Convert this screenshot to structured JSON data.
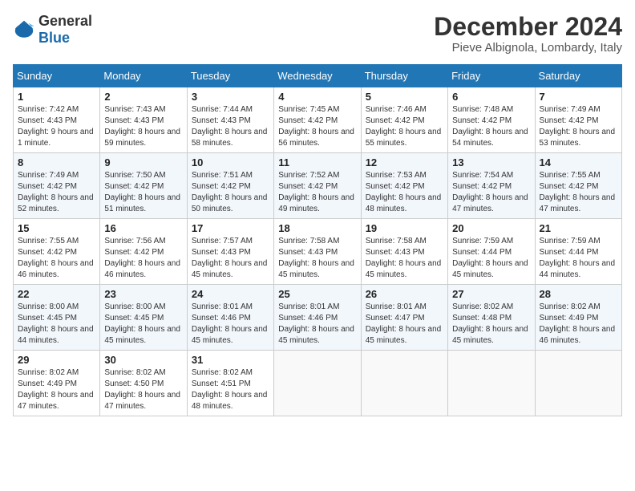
{
  "header": {
    "logo_general": "General",
    "logo_blue": "Blue",
    "title": "December 2024",
    "subtitle": "Pieve Albignola, Lombardy, Italy"
  },
  "weekdays": [
    "Sunday",
    "Monday",
    "Tuesday",
    "Wednesday",
    "Thursday",
    "Friday",
    "Saturday"
  ],
  "weeks": [
    [
      {
        "day": "1",
        "sunrise": "Sunrise: 7:42 AM",
        "sunset": "Sunset: 4:43 PM",
        "daylight": "Daylight: 9 hours and 1 minute."
      },
      {
        "day": "2",
        "sunrise": "Sunrise: 7:43 AM",
        "sunset": "Sunset: 4:43 PM",
        "daylight": "Daylight: 8 hours and 59 minutes."
      },
      {
        "day": "3",
        "sunrise": "Sunrise: 7:44 AM",
        "sunset": "Sunset: 4:43 PM",
        "daylight": "Daylight: 8 hours and 58 minutes."
      },
      {
        "day": "4",
        "sunrise": "Sunrise: 7:45 AM",
        "sunset": "Sunset: 4:42 PM",
        "daylight": "Daylight: 8 hours and 56 minutes."
      },
      {
        "day": "5",
        "sunrise": "Sunrise: 7:46 AM",
        "sunset": "Sunset: 4:42 PM",
        "daylight": "Daylight: 8 hours and 55 minutes."
      },
      {
        "day": "6",
        "sunrise": "Sunrise: 7:48 AM",
        "sunset": "Sunset: 4:42 PM",
        "daylight": "Daylight: 8 hours and 54 minutes."
      },
      {
        "day": "7",
        "sunrise": "Sunrise: 7:49 AM",
        "sunset": "Sunset: 4:42 PM",
        "daylight": "Daylight: 8 hours and 53 minutes."
      }
    ],
    [
      {
        "day": "8",
        "sunrise": "Sunrise: 7:49 AM",
        "sunset": "Sunset: 4:42 PM",
        "daylight": "Daylight: 8 hours and 52 minutes."
      },
      {
        "day": "9",
        "sunrise": "Sunrise: 7:50 AM",
        "sunset": "Sunset: 4:42 PM",
        "daylight": "Daylight: 8 hours and 51 minutes."
      },
      {
        "day": "10",
        "sunrise": "Sunrise: 7:51 AM",
        "sunset": "Sunset: 4:42 PM",
        "daylight": "Daylight: 8 hours and 50 minutes."
      },
      {
        "day": "11",
        "sunrise": "Sunrise: 7:52 AM",
        "sunset": "Sunset: 4:42 PM",
        "daylight": "Daylight: 8 hours and 49 minutes."
      },
      {
        "day": "12",
        "sunrise": "Sunrise: 7:53 AM",
        "sunset": "Sunset: 4:42 PM",
        "daylight": "Daylight: 8 hours and 48 minutes."
      },
      {
        "day": "13",
        "sunrise": "Sunrise: 7:54 AM",
        "sunset": "Sunset: 4:42 PM",
        "daylight": "Daylight: 8 hours and 47 minutes."
      },
      {
        "day": "14",
        "sunrise": "Sunrise: 7:55 AM",
        "sunset": "Sunset: 4:42 PM",
        "daylight": "Daylight: 8 hours and 47 minutes."
      }
    ],
    [
      {
        "day": "15",
        "sunrise": "Sunrise: 7:55 AM",
        "sunset": "Sunset: 4:42 PM",
        "daylight": "Daylight: 8 hours and 46 minutes."
      },
      {
        "day": "16",
        "sunrise": "Sunrise: 7:56 AM",
        "sunset": "Sunset: 4:42 PM",
        "daylight": "Daylight: 8 hours and 46 minutes."
      },
      {
        "day": "17",
        "sunrise": "Sunrise: 7:57 AM",
        "sunset": "Sunset: 4:43 PM",
        "daylight": "Daylight: 8 hours and 45 minutes."
      },
      {
        "day": "18",
        "sunrise": "Sunrise: 7:58 AM",
        "sunset": "Sunset: 4:43 PM",
        "daylight": "Daylight: 8 hours and 45 minutes."
      },
      {
        "day": "19",
        "sunrise": "Sunrise: 7:58 AM",
        "sunset": "Sunset: 4:43 PM",
        "daylight": "Daylight: 8 hours and 45 minutes."
      },
      {
        "day": "20",
        "sunrise": "Sunrise: 7:59 AM",
        "sunset": "Sunset: 4:44 PM",
        "daylight": "Daylight: 8 hours and 45 minutes."
      },
      {
        "day": "21",
        "sunrise": "Sunrise: 7:59 AM",
        "sunset": "Sunset: 4:44 PM",
        "daylight": "Daylight: 8 hours and 44 minutes."
      }
    ],
    [
      {
        "day": "22",
        "sunrise": "Sunrise: 8:00 AM",
        "sunset": "Sunset: 4:45 PM",
        "daylight": "Daylight: 8 hours and 44 minutes."
      },
      {
        "day": "23",
        "sunrise": "Sunrise: 8:00 AM",
        "sunset": "Sunset: 4:45 PM",
        "daylight": "Daylight: 8 hours and 45 minutes."
      },
      {
        "day": "24",
        "sunrise": "Sunrise: 8:01 AM",
        "sunset": "Sunset: 4:46 PM",
        "daylight": "Daylight: 8 hours and 45 minutes."
      },
      {
        "day": "25",
        "sunrise": "Sunrise: 8:01 AM",
        "sunset": "Sunset: 4:46 PM",
        "daylight": "Daylight: 8 hours and 45 minutes."
      },
      {
        "day": "26",
        "sunrise": "Sunrise: 8:01 AM",
        "sunset": "Sunset: 4:47 PM",
        "daylight": "Daylight: 8 hours and 45 minutes."
      },
      {
        "day": "27",
        "sunrise": "Sunrise: 8:02 AM",
        "sunset": "Sunset: 4:48 PM",
        "daylight": "Daylight: 8 hours and 45 minutes."
      },
      {
        "day": "28",
        "sunrise": "Sunrise: 8:02 AM",
        "sunset": "Sunset: 4:49 PM",
        "daylight": "Daylight: 8 hours and 46 minutes."
      }
    ],
    [
      {
        "day": "29",
        "sunrise": "Sunrise: 8:02 AM",
        "sunset": "Sunset: 4:49 PM",
        "daylight": "Daylight: 8 hours and 47 minutes."
      },
      {
        "day": "30",
        "sunrise": "Sunrise: 8:02 AM",
        "sunset": "Sunset: 4:50 PM",
        "daylight": "Daylight: 8 hours and 47 minutes."
      },
      {
        "day": "31",
        "sunrise": "Sunrise: 8:02 AM",
        "sunset": "Sunset: 4:51 PM",
        "daylight": "Daylight: 8 hours and 48 minutes."
      },
      null,
      null,
      null,
      null
    ]
  ]
}
